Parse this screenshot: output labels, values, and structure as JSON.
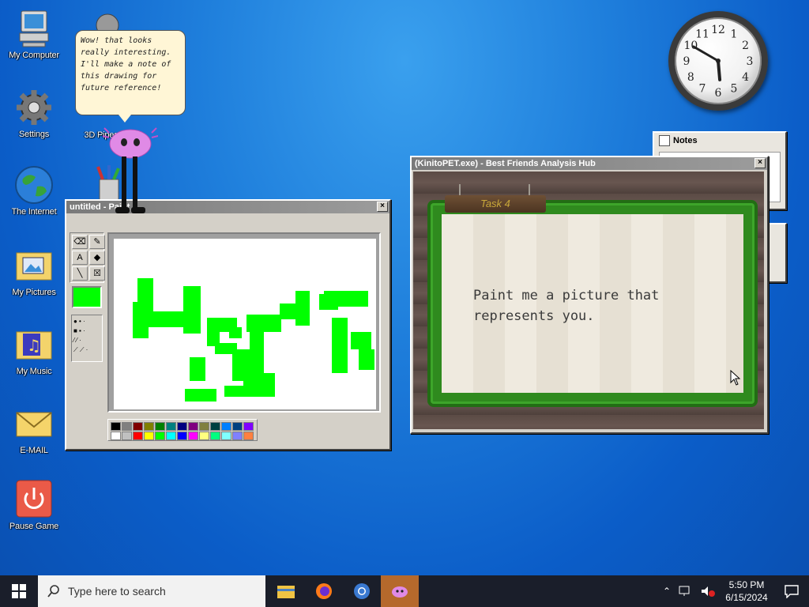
{
  "desktop": {
    "icons": [
      {
        "label": "My Computer"
      },
      {
        "label": "Settings"
      },
      {
        "label": "The Internet"
      },
      {
        "label": "My Pictures"
      },
      {
        "label": "My Music"
      },
      {
        "label": "E-MAIL"
      },
      {
        "label": "Pause Game"
      },
      {
        "label": "3D Pipes"
      }
    ]
  },
  "bubble": {
    "text": "Wow! that looks really interesting. I'll make a note of this drawing for future reference!"
  },
  "paint": {
    "title": "untitled - Paint",
    "close": "×",
    "current_color": "#00ff00",
    "palette_top": [
      "#000000",
      "#808080",
      "#800000",
      "#808000",
      "#008000",
      "#008080",
      "#000080",
      "#800080",
      "#808040",
      "#004040",
      "#0080ff",
      "#004080",
      "#8000ff"
    ],
    "palette_bottom": [
      "#ffffff",
      "#c0c0c0",
      "#ff0000",
      "#ffff00",
      "#00ff00",
      "#00ffff",
      "#0000ff",
      "#ff00ff",
      "#ffff80",
      "#00ff80",
      "#80ffff",
      "#8080ff",
      "#ff8040"
    ]
  },
  "kinito": {
    "title": "(KinitoPET.exe) - Best Friends Analysis Hub",
    "close": "×",
    "task_label": "Task 4",
    "prompt": "Paint me a picture that represents you."
  },
  "notes": {
    "title": "Notes"
  },
  "taskbar": {
    "search_placeholder": "Type here to search",
    "time": "5:50 PM",
    "date": "6/15/2024"
  },
  "clock": {
    "numbers": [
      "12",
      "1",
      "2",
      "3",
      "4",
      "5",
      "6",
      "7",
      "8",
      "9",
      "10",
      "11"
    ],
    "hour": 5,
    "minute": 50
  }
}
